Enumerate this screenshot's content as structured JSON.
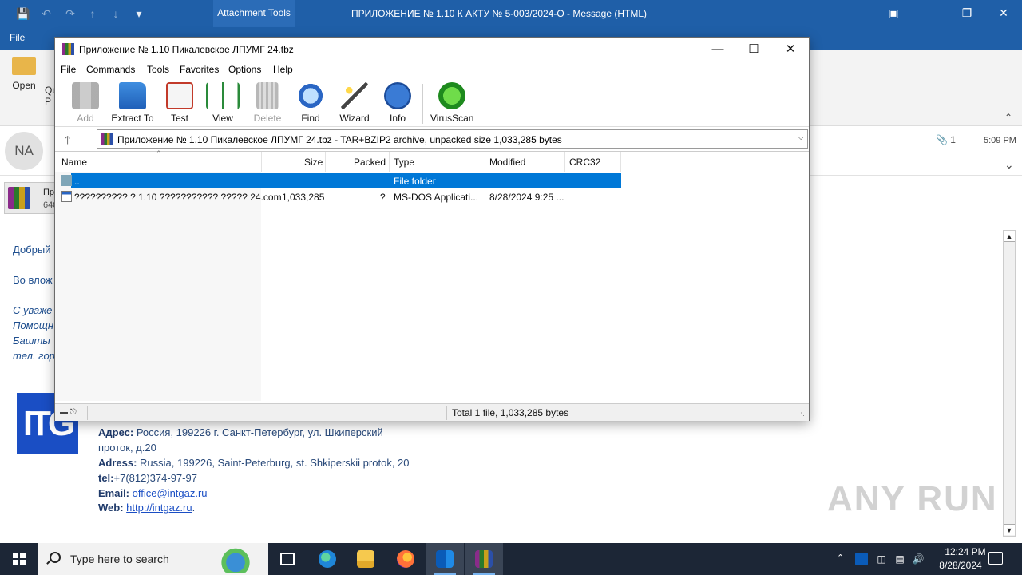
{
  "outlook": {
    "title": "ПРИЛОЖЕНИЕ № 1.10 К АКТУ № 5-003/2024-О  -  Message (HTML)",
    "contextual_tab": "Attachment Tools",
    "file_tab": "File",
    "open_label": "Open",
    "qu_label": "Qu",
    "p_label": "P",
    "avatar_initials": "NA",
    "attachment_count": "1",
    "time": "5:09 PM",
    "attachment_chip_line1": "Пр",
    "attachment_chip_line2": "640",
    "body_lines": [
      "Добрый",
      "Во влож",
      "С уваже",
      "Помощн",
      "Башты",
      "тел. гор"
    ],
    "signature": {
      "addr_label": "Адрес:",
      "addr_value": "Россия, 199226  г. Санкт-Петербург, ул. Шкиперский",
      "addr_value2": "проток, д.20",
      "adress_label": "Adress:",
      "adress_value": "Russia, 199226,  Saint-Peterburg, st. Shkiperskii protok, 20",
      "tel_label": "tel:",
      "tel_value": "+7(812)374-97-97",
      "email_label": "Email:",
      "email_value": "office@intgaz.ru",
      "web_label": "Web:",
      "web_value": "http://intgaz.ru"
    },
    "logo_text": "ITG",
    "watermark": "ANY RUN"
  },
  "winrar": {
    "title": "Приложение № 1.10 Пикалевское ЛПУМГ 24.tbz",
    "menu": [
      "File",
      "Commands",
      "Tools",
      "Favorites",
      "Options",
      "Help"
    ],
    "toolbar": [
      {
        "label": "Add",
        "icon": "add-icon",
        "enabled": false
      },
      {
        "label": "Extract To",
        "icon": "extract-folder-icon",
        "enabled": true
      },
      {
        "label": "Test",
        "icon": "test-checklist-icon",
        "enabled": true
      },
      {
        "label": "View",
        "icon": "view-book-icon",
        "enabled": true
      },
      {
        "label": "Delete",
        "icon": "trash-icon",
        "enabled": false
      },
      {
        "label": "Find",
        "icon": "magnifier-icon",
        "enabled": true
      },
      {
        "label": "Wizard",
        "icon": "wand-icon",
        "enabled": true
      },
      {
        "label": "Info",
        "icon": "info-icon",
        "enabled": true
      },
      {
        "label": "VirusScan",
        "icon": "virus-scan-icon",
        "enabled": true
      }
    ],
    "address": "Приложение № 1.10 Пикалевское ЛПУМГ 24.tbz - TAR+BZIP2 archive, unpacked size 1,033,285 bytes",
    "columns": [
      "Name",
      "Size",
      "Packed",
      "Type",
      "Modified",
      "CRC32"
    ],
    "rows": [
      {
        "name": "..",
        "size": "",
        "packed": "",
        "type": "File folder",
        "modified": "",
        "crc": ""
      },
      {
        "name": "?????????? ? 1.10 ??????????? ????? 24.com",
        "size": "1,033,285",
        "packed": "?",
        "type": "MS-DOS Applicati...",
        "modified": "8/28/2024 9:25 ...",
        "crc": ""
      }
    ],
    "status": "Total 1 file, 1,033,285 bytes"
  },
  "taskbar": {
    "search_placeholder": "Type here to search",
    "clock_time": "12:24 PM",
    "clock_date": "8/28/2024"
  },
  "colors": {
    "outlook_blue": "#1f5fa8",
    "selection_blue": "#0078d7",
    "taskbar": "#1c2636"
  }
}
